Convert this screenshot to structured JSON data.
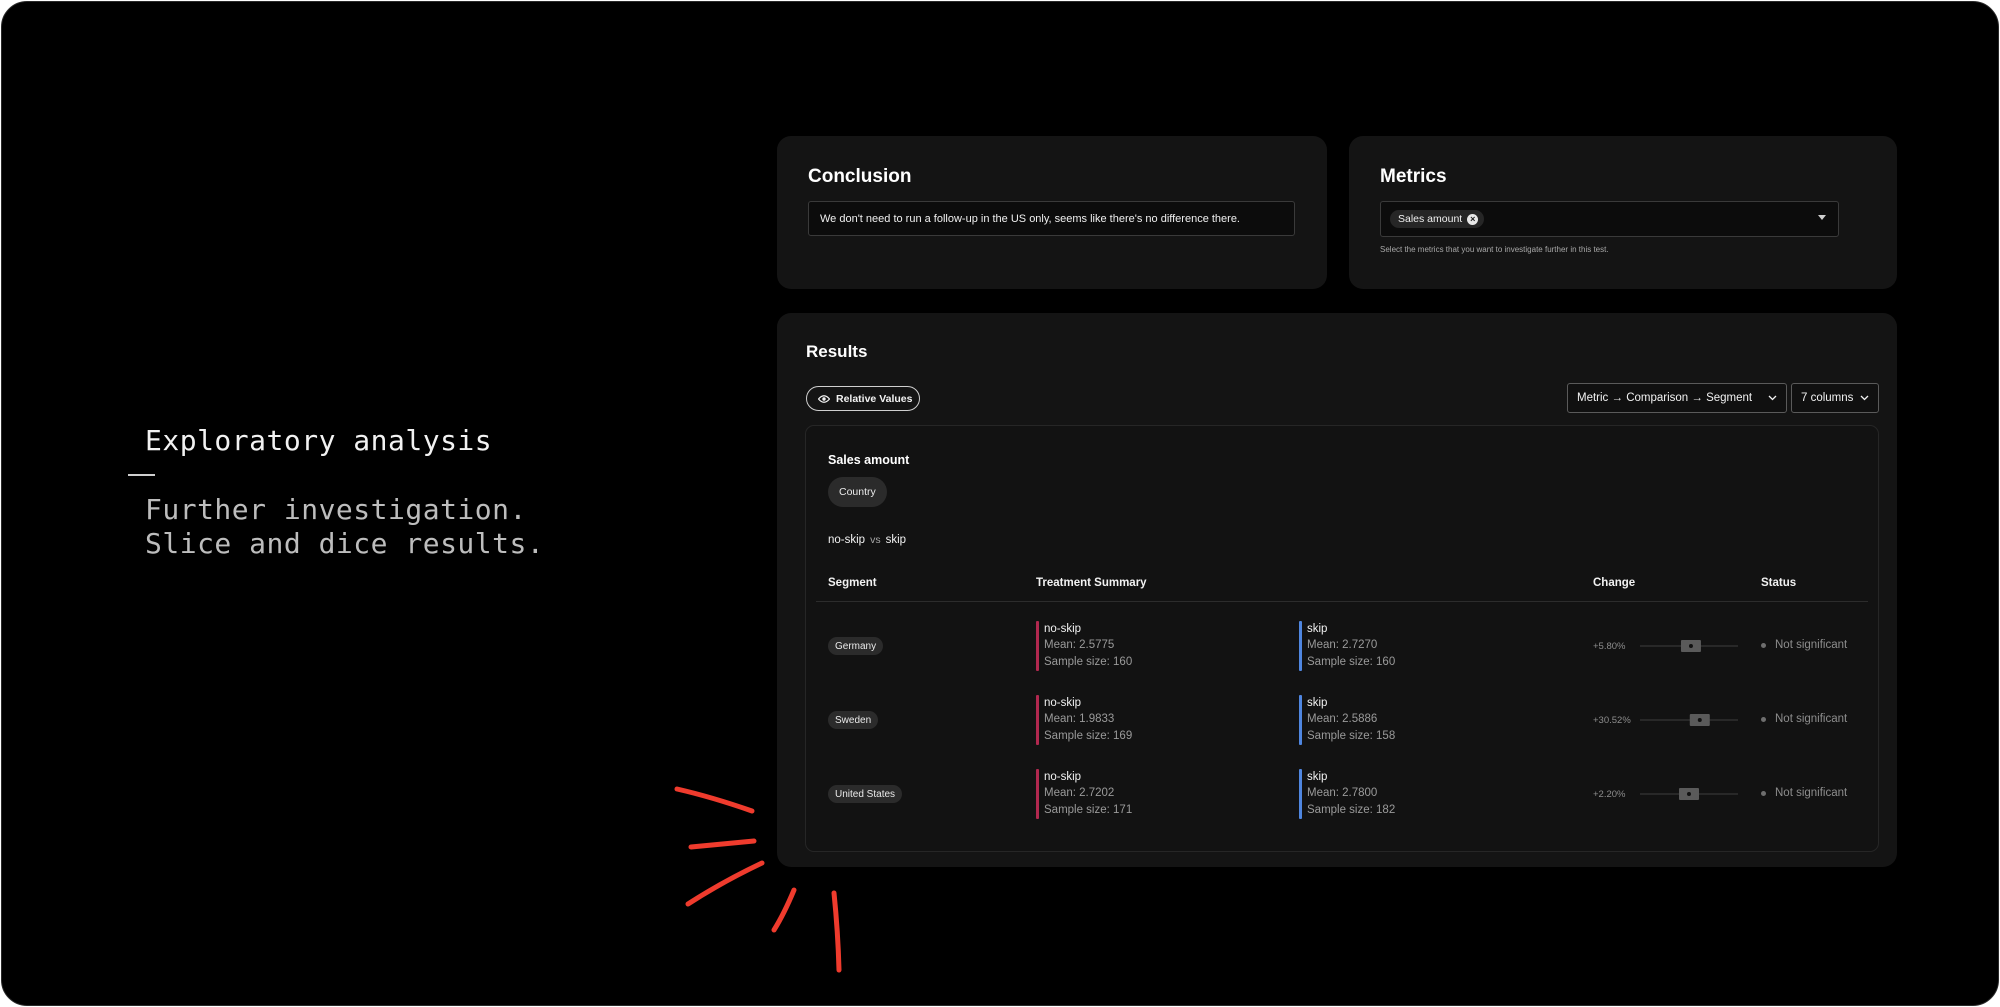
{
  "intro": {
    "title": "Exploratory analysis",
    "subtitle_line1": "Further investigation.",
    "subtitle_line2": "Slice and dice results."
  },
  "conclusion": {
    "title": "Conclusion",
    "text": "We don't need to run a follow-up in the US only, seems like there's no difference there."
  },
  "metrics": {
    "title": "Metrics",
    "selected_chip": "Sales amount",
    "help_text": "Select the metrics that you want to investigate further in this test."
  },
  "results": {
    "title": "Results",
    "relative_values_label": "Relative Values",
    "order_dropdown": "Metric → Comparison → Segment",
    "columns_dropdown": "7 columns",
    "metric_name": "Sales amount",
    "dimension_chip": "Country",
    "comparison": {
      "a": "no-skip",
      "vs": "vs",
      "b": "skip"
    },
    "headers": {
      "segment": "Segment",
      "treatment_summary": "Treatment Summary",
      "change": "Change",
      "status": "Status"
    },
    "rows": [
      {
        "segment": "Germany",
        "a": {
          "name": "no-skip",
          "mean": "Mean: 2.5775",
          "sample": "Sample size: 160"
        },
        "b": {
          "name": "skip",
          "mean": "Mean: 2.7270",
          "sample": "Sample size: 160"
        },
        "change": "+5.80%",
        "ci_estimate": 0.52,
        "status": "Not significant"
      },
      {
        "segment": "Sweden",
        "a": {
          "name": "no-skip",
          "mean": "Mean: 1.9833",
          "sample": "Sample size: 169"
        },
        "b": {
          "name": "skip",
          "mean": "Mean: 2.5886",
          "sample": "Sample size: 158"
        },
        "change": "+30.52%",
        "ci_estimate": 0.61,
        "status": "Not significant"
      },
      {
        "segment": "United States",
        "a": {
          "name": "no-skip",
          "mean": "Mean: 2.7202",
          "sample": "Sample size: 171"
        },
        "b": {
          "name": "skip",
          "mean": "Mean: 2.7800",
          "sample": "Sample size: 182"
        },
        "change": "+2.20%",
        "ci_estimate": 0.5,
        "status": "Not significant"
      }
    ]
  },
  "colors": {
    "control_bar": "#b2284f",
    "treatment_bar": "#4f86e0",
    "annotation": "#ef3b2d"
  }
}
